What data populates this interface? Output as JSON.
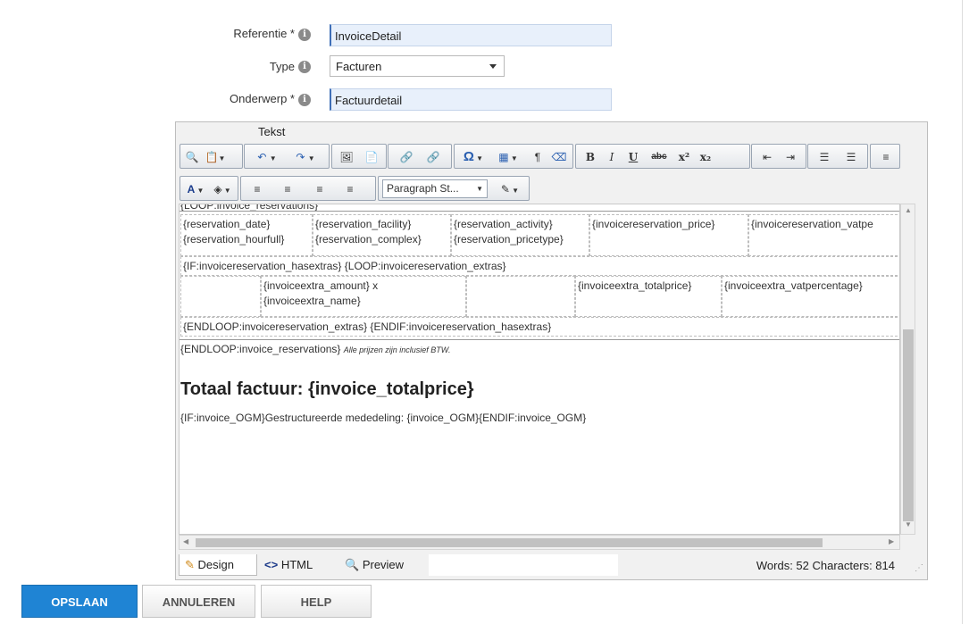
{
  "form": {
    "reference": {
      "label": "Referentie *",
      "value": "InvoiceDetail"
    },
    "type": {
      "label": "Type",
      "value": "Facturen"
    },
    "subject": {
      "label": "Onderwerp *",
      "value": "Factuurdetail"
    }
  },
  "editor": {
    "title": "Tekst",
    "toolbar_row2": {
      "paragraph_style": "Paragraph St..."
    },
    "content": {
      "loop_start": "{LOOP:invoice_reservations}",
      "row1": [
        "{reservation_date}",
        "{reservation_facility}",
        "{reservation_activity}",
        "{invoicereservation_price}",
        "{invoicereservation_vatpe"
      ],
      "row1b": [
        "{reservation_hourfull}",
        "{reservation_complex}",
        "{reservation_pricetype}"
      ],
      "if_line": "{IF:invoicereservation_hasextras} {LOOP:invoicereservation_extras}",
      "extra_amount": "{invoiceextra_amount} x",
      "extra_name": "{invoiceextra_name}",
      "extra_total": "{invoiceextra_totalprice}",
      "extra_vat": "{invoiceextra_vatpercentage}",
      "endloop_line": "{ENDLOOP:invoicereservation_extras} {ENDIF:invoicereservation_hasextras}",
      "end_reservations": "{ENDLOOP:invoice_reservations}",
      "vat_note": "Alle prijzen zijn inclusief BTW.",
      "total_heading": "Totaal factuur: {invoice_totalprice}",
      "ogm_line": "{IF:invoice_OGM}Gestructureerde mededeling: {invoice_OGM}{ENDIF:invoice_OGM}"
    },
    "modes": [
      "Design",
      "HTML",
      "Preview"
    ],
    "stats": "Words: 52   Characters: 814"
  },
  "buttons": {
    "save": "OPSLAAN",
    "cancel": "ANNULEREN",
    "help": "HELP"
  },
  "colors": {
    "primary": "#1f84d4",
    "input_bg": "#e8f0fb"
  }
}
